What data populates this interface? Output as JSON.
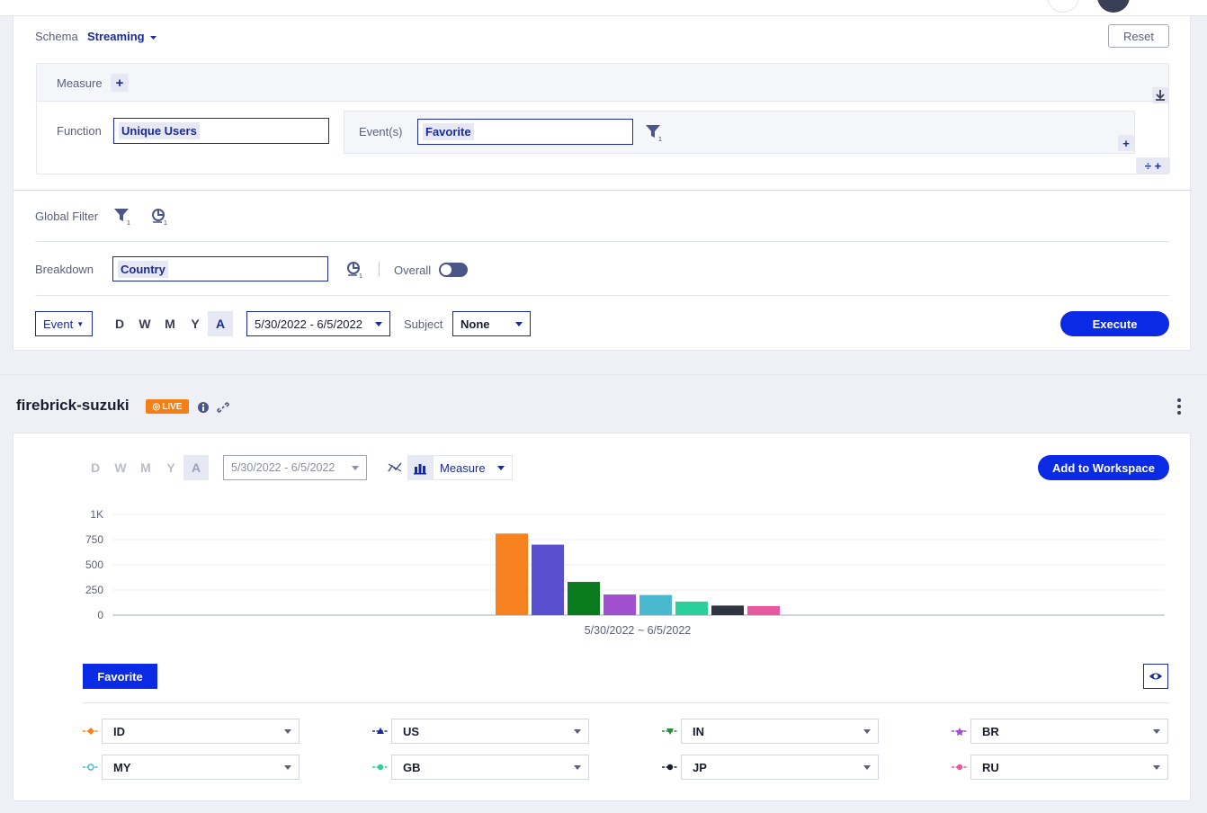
{
  "query": {
    "schema_label": "Schema",
    "schema_value": "Streaming",
    "reset_label": "Reset",
    "measure_label": "Measure",
    "function_label": "Function",
    "function_value": "Unique Users",
    "events_label": "Event(s)",
    "events_value": "Favorite",
    "event_filter_count": "1",
    "global_filter_label": "Global Filter",
    "global_filter_count": "1",
    "global_segment_count": "1",
    "breakdown_label": "Breakdown",
    "breakdown_value": "Country",
    "breakdown_segment_count": "1",
    "overall_label": "Overall",
    "event_mode": "Event",
    "granularity": [
      "D",
      "W",
      "M",
      "Y",
      "A"
    ],
    "granularity_active": "A",
    "date_range": "5/30/2022 - 6/5/2022",
    "subject_label": "Subject",
    "subject_value": "None",
    "execute_label": "Execute"
  },
  "report": {
    "title": "firebrick-suzuki",
    "live_badge": "LIVE",
    "granularity": [
      "D",
      "W",
      "M",
      "Y",
      "A"
    ],
    "granularity_active": "A",
    "date_range": "5/30/2022 - 6/5/2022",
    "measure_label": "Measure",
    "add_to_workspace_label": "Add to Workspace",
    "series_tab_label": "Favorite"
  },
  "chart_data": {
    "type": "bar",
    "x_label": "5/30/2022 ~ 6/5/2022",
    "y_ticks": [
      "1K",
      "750",
      "500",
      "250",
      "0"
    ],
    "ylim": [
      0,
      1000
    ],
    "grid": true,
    "series": [
      {
        "name": "ID",
        "value": 810,
        "color": "#f5821f"
      },
      {
        "name": "US",
        "value": 700,
        "color": "#5a4fcf"
      },
      {
        "name": "IN",
        "value": 330,
        "color": "#0a7a1e"
      },
      {
        "name": "BR",
        "value": 205,
        "color": "#a04fcf"
      },
      {
        "name": "MY",
        "value": 200,
        "color": "#4ab8cf"
      },
      {
        "name": "GB",
        "value": 135,
        "color": "#2acf9a"
      },
      {
        "name": "JP",
        "value": 95,
        "color": "#2e3440"
      },
      {
        "name": "RU",
        "value": 90,
        "color": "#e85aa0"
      }
    ]
  },
  "legend": [
    {
      "label": "ID",
      "color": "#f5821f",
      "marker": "diamond"
    },
    {
      "label": "US",
      "color": "#1a2a9a",
      "marker": "triangle"
    },
    {
      "label": "IN",
      "color": "#2a8a3e",
      "marker": "triangle-down"
    },
    {
      "label": "BR",
      "color": "#a04fcf",
      "marker": "star"
    },
    {
      "label": "MY",
      "color": "#4ab8cf",
      "marker": "circle-open"
    },
    {
      "label": "GB",
      "color": "#2acf9a",
      "marker": "circle"
    },
    {
      "label": "JP",
      "color": "#1a1d2e",
      "marker": "circle"
    },
    {
      "label": "RU",
      "color": "#e85aa0",
      "marker": "circle"
    }
  ]
}
